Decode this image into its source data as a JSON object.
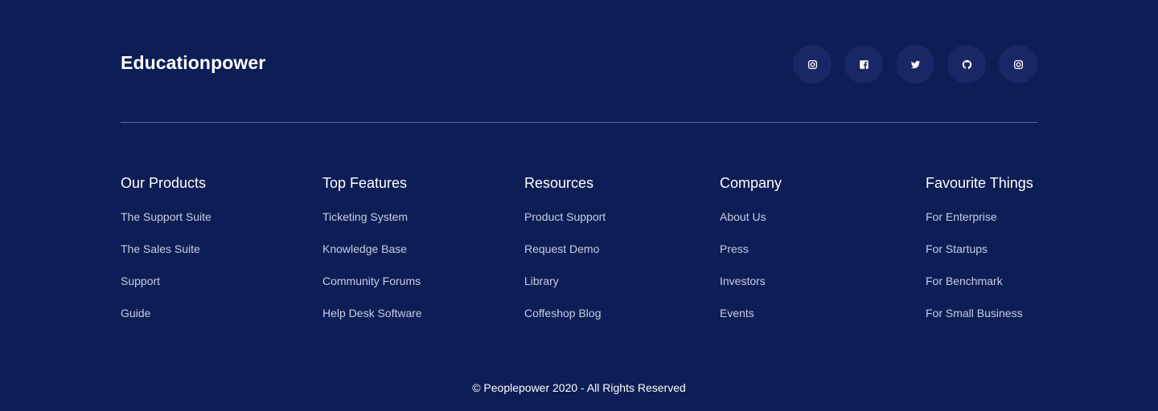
{
  "brand": {
    "name": "Educationpower"
  },
  "socials": [
    {
      "icon": "instagram-icon"
    },
    {
      "icon": "facebook-icon"
    },
    {
      "icon": "twitter-icon"
    },
    {
      "icon": "github-icon"
    },
    {
      "icon": "instagram-icon"
    }
  ],
  "columns": [
    {
      "title": "Our Products",
      "links": [
        "The Support Suite",
        "The Sales Suite",
        "Support",
        "Guide"
      ]
    },
    {
      "title": "Top Features",
      "links": [
        "Ticketing System",
        "Knowledge Base",
        "Community Forums",
        "Help Desk Software"
      ]
    },
    {
      "title": "Resources",
      "links": [
        "Product Support",
        "Request Demo",
        "Library",
        "Coffeshop Blog"
      ]
    },
    {
      "title": "Company",
      "links": [
        "About Us",
        "Press",
        "Investors",
        "Events"
      ]
    },
    {
      "title": "Favourite Things",
      "links": [
        "For Enterprise",
        "For Startups",
        "For Benchmark",
        "For Small Business"
      ]
    }
  ],
  "copyright": "© Peoplepower 2020 - All Rights Reserved",
  "colors": {
    "background": "#0d1d56",
    "social_bg": "#1a2766",
    "divider": "#5c6892",
    "link": "#c9cde0"
  }
}
